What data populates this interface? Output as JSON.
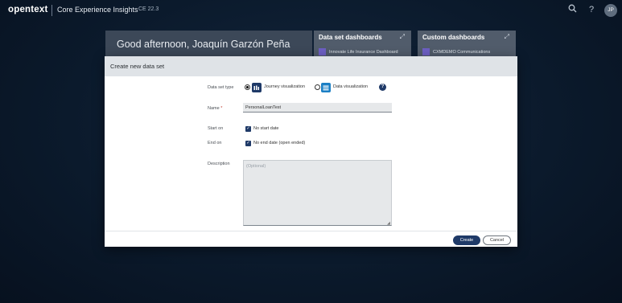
{
  "topbar": {
    "logo": "opentext",
    "app_title": "Core Experience Insights",
    "version": "CE 22.3",
    "search_icon": "search-icon",
    "help_icon": "help-icon",
    "avatar_initials": "JP"
  },
  "background": {
    "greeting": "Good afternoon, Joaquín Garzón Peña",
    "dataset_dashboards": {
      "title": "Data set dashboards",
      "first_item": "Innovate Life Insurance Dashboard"
    },
    "custom_dashboards": {
      "title": "Custom dashboards",
      "first_item": "CXMDEMO Communications"
    }
  },
  "modal": {
    "title": "Create new data set",
    "dataset_type": {
      "label": "Data set type",
      "options": [
        {
          "label": "Journey visualization",
          "selected": true,
          "icon": "journey-visualization-icon",
          "color": "#1f3a68"
        },
        {
          "label": "Data visualization",
          "selected": false,
          "icon": "data-visualization-icon",
          "color": "#1b7fc4"
        }
      ]
    },
    "name": {
      "label": "Name",
      "required_mark": "*",
      "value": "PersonalLoanTest"
    },
    "start_on": {
      "label": "Start on",
      "checkbox_label": "No start date",
      "checked": true
    },
    "end_on": {
      "label": "End on",
      "checkbox_label": "No end date (open ended)",
      "checked": true
    },
    "description": {
      "label": "Description",
      "placeholder": "(Optional)",
      "value": ""
    },
    "buttons": {
      "create": "Create",
      "cancel": "Cancel"
    }
  }
}
